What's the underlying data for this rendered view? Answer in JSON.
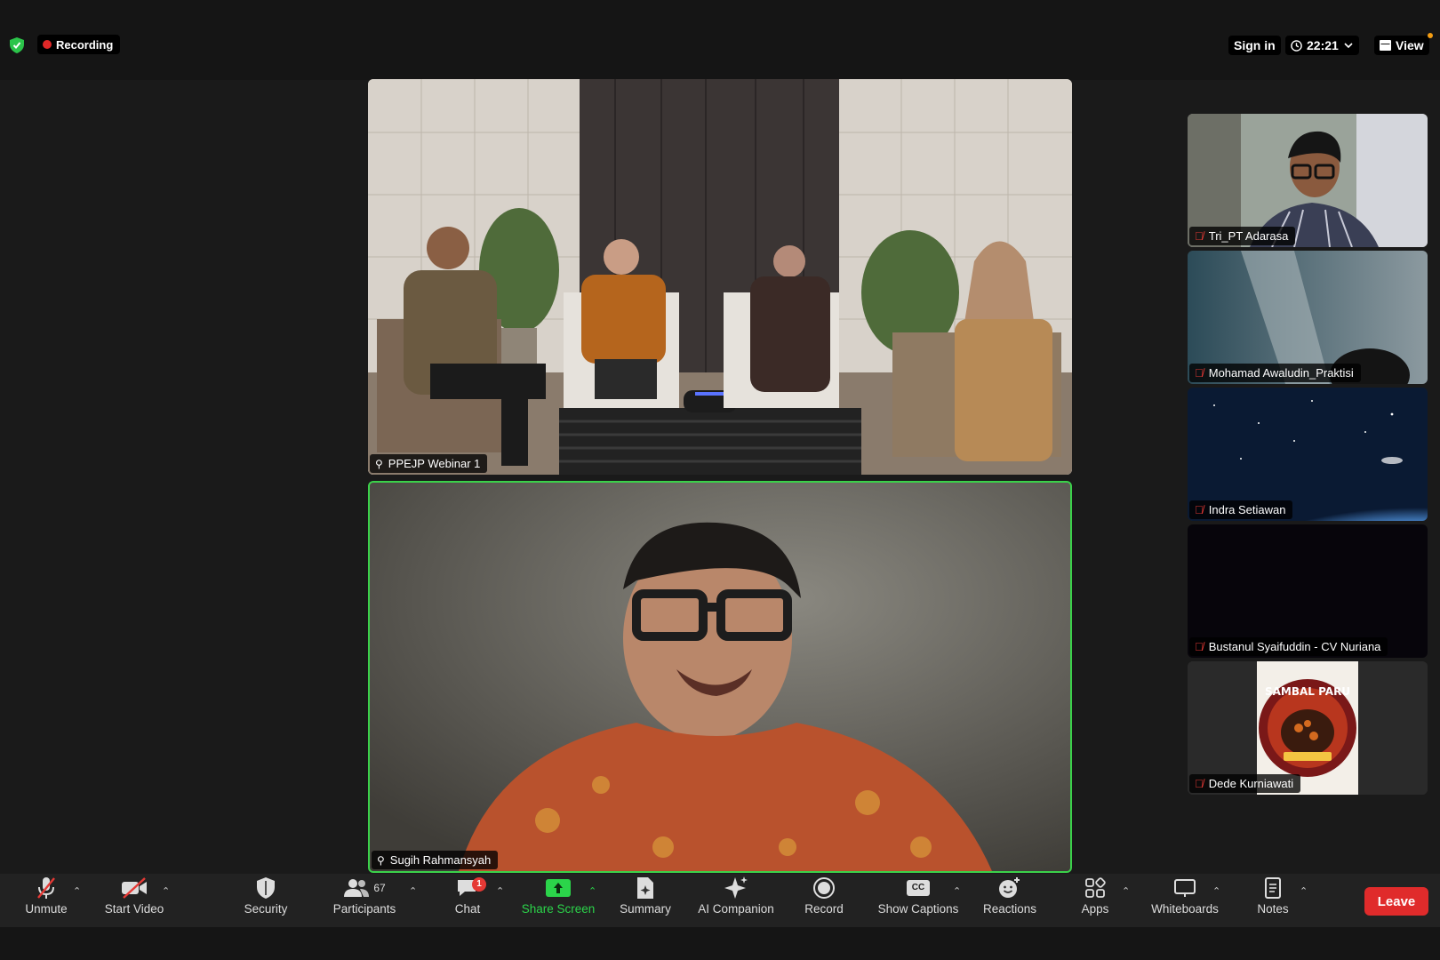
{
  "topbar": {
    "recording_label": "Recording",
    "sign_in_label": "Sign in",
    "time": "22:21",
    "view_label": "View"
  },
  "main_tiles": [
    {
      "name": "PPEJP Webinar 1"
    },
    {
      "name": "Sugih Rahmansyah"
    }
  ],
  "participants": [
    {
      "name": "Tri_PT Adarasa"
    },
    {
      "name": "Mohamad Awaludin_Praktisi"
    },
    {
      "name": "Indra Setiawan"
    },
    {
      "name": "Bustanul Syaifuddin - CV Nuriana"
    },
    {
      "name": "Dede Kurniawati"
    }
  ],
  "avatar_logo_text": "SAMBAL PARU",
  "toolbar": {
    "unmute": "Unmute",
    "start_video": "Start Video",
    "security": "Security",
    "participants": "Participants",
    "participants_count": "67",
    "chat": "Chat",
    "chat_badge": "1",
    "share_screen": "Share Screen",
    "summary": "Summary",
    "ai_companion": "AI Companion",
    "record": "Record",
    "show_captions": "Show Captions",
    "captions_icon_text": "CC",
    "reactions": "Reactions",
    "apps": "Apps",
    "whiteboards": "Whiteboards",
    "notes": "Notes",
    "leave": "Leave"
  },
  "colors": {
    "active_speaker_border": "#3bd14a",
    "share_screen": "#2bd44a",
    "leave_button": "#e02b2b",
    "recording_dot": "#e02828"
  }
}
